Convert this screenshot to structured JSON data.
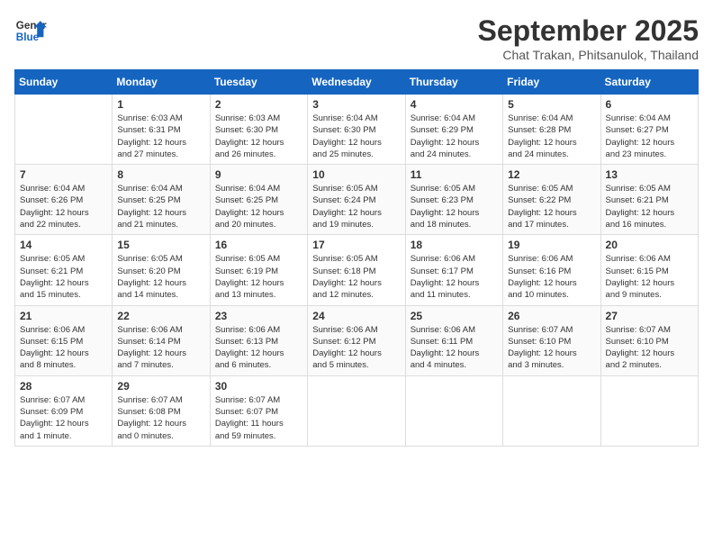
{
  "header": {
    "logo_general": "General",
    "logo_blue": "Blue",
    "month_year": "September 2025",
    "location": "Chat Trakan, Phitsanulok, Thailand"
  },
  "weekdays": [
    "Sunday",
    "Monday",
    "Tuesday",
    "Wednesday",
    "Thursday",
    "Friday",
    "Saturday"
  ],
  "weeks": [
    [
      {
        "day": "",
        "info": ""
      },
      {
        "day": "1",
        "info": "Sunrise: 6:03 AM\nSunset: 6:31 PM\nDaylight: 12 hours\nand 27 minutes."
      },
      {
        "day": "2",
        "info": "Sunrise: 6:03 AM\nSunset: 6:30 PM\nDaylight: 12 hours\nand 26 minutes."
      },
      {
        "day": "3",
        "info": "Sunrise: 6:04 AM\nSunset: 6:30 PM\nDaylight: 12 hours\nand 25 minutes."
      },
      {
        "day": "4",
        "info": "Sunrise: 6:04 AM\nSunset: 6:29 PM\nDaylight: 12 hours\nand 24 minutes."
      },
      {
        "day": "5",
        "info": "Sunrise: 6:04 AM\nSunset: 6:28 PM\nDaylight: 12 hours\nand 24 minutes."
      },
      {
        "day": "6",
        "info": "Sunrise: 6:04 AM\nSunset: 6:27 PM\nDaylight: 12 hours\nand 23 minutes."
      }
    ],
    [
      {
        "day": "7",
        "info": "Sunrise: 6:04 AM\nSunset: 6:26 PM\nDaylight: 12 hours\nand 22 minutes."
      },
      {
        "day": "8",
        "info": "Sunrise: 6:04 AM\nSunset: 6:25 PM\nDaylight: 12 hours\nand 21 minutes."
      },
      {
        "day": "9",
        "info": "Sunrise: 6:04 AM\nSunset: 6:25 PM\nDaylight: 12 hours\nand 20 minutes."
      },
      {
        "day": "10",
        "info": "Sunrise: 6:05 AM\nSunset: 6:24 PM\nDaylight: 12 hours\nand 19 minutes."
      },
      {
        "day": "11",
        "info": "Sunrise: 6:05 AM\nSunset: 6:23 PM\nDaylight: 12 hours\nand 18 minutes."
      },
      {
        "day": "12",
        "info": "Sunrise: 6:05 AM\nSunset: 6:22 PM\nDaylight: 12 hours\nand 17 minutes."
      },
      {
        "day": "13",
        "info": "Sunrise: 6:05 AM\nSunset: 6:21 PM\nDaylight: 12 hours\nand 16 minutes."
      }
    ],
    [
      {
        "day": "14",
        "info": "Sunrise: 6:05 AM\nSunset: 6:21 PM\nDaylight: 12 hours\nand 15 minutes."
      },
      {
        "day": "15",
        "info": "Sunrise: 6:05 AM\nSunset: 6:20 PM\nDaylight: 12 hours\nand 14 minutes."
      },
      {
        "day": "16",
        "info": "Sunrise: 6:05 AM\nSunset: 6:19 PM\nDaylight: 12 hours\nand 13 minutes."
      },
      {
        "day": "17",
        "info": "Sunrise: 6:05 AM\nSunset: 6:18 PM\nDaylight: 12 hours\nand 12 minutes."
      },
      {
        "day": "18",
        "info": "Sunrise: 6:06 AM\nSunset: 6:17 PM\nDaylight: 12 hours\nand 11 minutes."
      },
      {
        "day": "19",
        "info": "Sunrise: 6:06 AM\nSunset: 6:16 PM\nDaylight: 12 hours\nand 10 minutes."
      },
      {
        "day": "20",
        "info": "Sunrise: 6:06 AM\nSunset: 6:15 PM\nDaylight: 12 hours\nand 9 minutes."
      }
    ],
    [
      {
        "day": "21",
        "info": "Sunrise: 6:06 AM\nSunset: 6:15 PM\nDaylight: 12 hours\nand 8 minutes."
      },
      {
        "day": "22",
        "info": "Sunrise: 6:06 AM\nSunset: 6:14 PM\nDaylight: 12 hours\nand 7 minutes."
      },
      {
        "day": "23",
        "info": "Sunrise: 6:06 AM\nSunset: 6:13 PM\nDaylight: 12 hours\nand 6 minutes."
      },
      {
        "day": "24",
        "info": "Sunrise: 6:06 AM\nSunset: 6:12 PM\nDaylight: 12 hours\nand 5 minutes."
      },
      {
        "day": "25",
        "info": "Sunrise: 6:06 AM\nSunset: 6:11 PM\nDaylight: 12 hours\nand 4 minutes."
      },
      {
        "day": "26",
        "info": "Sunrise: 6:07 AM\nSunset: 6:10 PM\nDaylight: 12 hours\nand 3 minutes."
      },
      {
        "day": "27",
        "info": "Sunrise: 6:07 AM\nSunset: 6:10 PM\nDaylight: 12 hours\nand 2 minutes."
      }
    ],
    [
      {
        "day": "28",
        "info": "Sunrise: 6:07 AM\nSunset: 6:09 PM\nDaylight: 12 hours\nand 1 minute."
      },
      {
        "day": "29",
        "info": "Sunrise: 6:07 AM\nSunset: 6:08 PM\nDaylight: 12 hours\nand 0 minutes."
      },
      {
        "day": "30",
        "info": "Sunrise: 6:07 AM\nSunset: 6:07 PM\nDaylight: 11 hours\nand 59 minutes."
      },
      {
        "day": "",
        "info": ""
      },
      {
        "day": "",
        "info": ""
      },
      {
        "day": "",
        "info": ""
      },
      {
        "day": "",
        "info": ""
      }
    ]
  ]
}
